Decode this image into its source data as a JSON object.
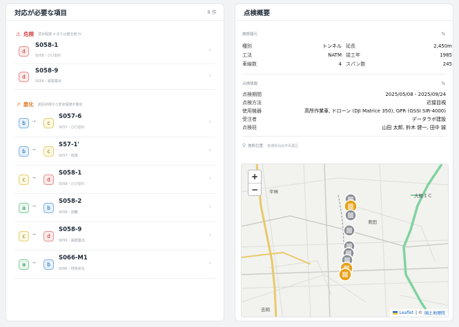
{
  "left": {
    "title": "対応が必要な項目",
    "count": "8 件",
    "danger": {
      "label": "危険",
      "desc": "変状程度 d または健全度 IV",
      "color": "#d64545"
    },
    "worse": {
      "label": "悪化",
      "desc": "前回点検から変状程度が悪化",
      "color": "#e07b2a"
    },
    "danger_items": [
      {
        "grade": "d",
        "name": "S058-1",
        "sub": "S058・ひび割れ"
      },
      {
        "grade": "d",
        "name": "S058-9",
        "sub": "S056・鉄筋露出"
      }
    ],
    "worse_items": [
      {
        "from": "b",
        "to": "c",
        "name": "S057-6",
        "sub": "S057・ひび割れ"
      },
      {
        "from": "b",
        "to": "c",
        "name": "S57-1'",
        "sub": "S057・剥落"
      },
      {
        "from": "c",
        "to": "d",
        "name": "S058-1",
        "sub": "S058・ひび割れ"
      },
      {
        "from": "a",
        "to": "b",
        "name": "S058-2",
        "sub": "S058・剥離"
      },
      {
        "from": "c",
        "to": "d",
        "name": "S058-9",
        "sub": "S056・鉄筋露出"
      },
      {
        "from": "a",
        "to": "b",
        "name": "S066-M1",
        "sub": "S066・材質劣化"
      }
    ]
  },
  "right": {
    "title": "点検概要",
    "facility": {
      "label": "施設諸元",
      "rows": [
        {
          "k1": "種別",
          "v1": "トンネル",
          "k2": "延長",
          "v2": "2,450m"
        },
        {
          "k1": "工法",
          "v1": "NATM",
          "k2": "竣工年",
          "v2": "1985"
        },
        {
          "k1": "車線数",
          "v1": "4",
          "k2": "スパン数",
          "v2": "245"
        }
      ]
    },
    "inspection": {
      "label": "点検情報",
      "rows": [
        {
          "k": "点検期間",
          "v": "2025/05/08 - 2025/09/24"
        },
        {
          "k": "点検方法",
          "v": "近接目視"
        },
        {
          "k": "使用機器",
          "v": "高所作業車, ドローン (DJI Matrice 350), GPR (GSSI SIR-4000)"
        },
        {
          "k": "受注者",
          "v": "データラボ建設"
        },
        {
          "k": "点検班",
          "v": "山田 太郎, 鈴木 健一, 田中 誠"
        }
      ]
    },
    "location": {
      "label": "施設位置",
      "address": "宮城県仙台市青葉区"
    },
    "map": {
      "zoom_in": "+",
      "zoom_out": "−",
      "labels": {
        "hirabayashi": "平林",
        "okuda": "奥田",
        "ic": "大衡ＩＣ",
        "yoshioka": "吉岡"
      },
      "attribution": {
        "leaflet": "Leaflet",
        "sep": "| ©",
        "source": "国土地理院"
      },
      "colors": {
        "road_main": "#7fd3a0",
        "road_yellow": "#e8c96a",
        "marker_orange": "#e8a21a",
        "marker_gray": "#8b8f96"
      }
    }
  }
}
